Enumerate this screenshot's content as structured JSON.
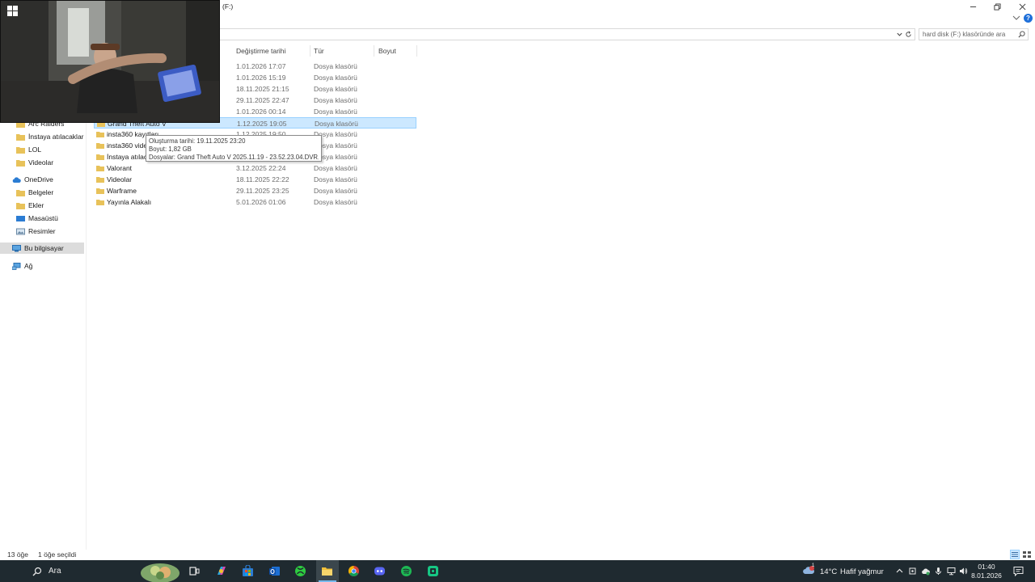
{
  "window": {
    "title": "(F:)",
    "search_placeholder": "hard disk (F:) klasöründe ara"
  },
  "columns": {
    "date": "Değiştirme tarihi",
    "type": "Tür",
    "size": "Boyut"
  },
  "files": [
    {
      "name": "",
      "date": "1.01.2026 17:07",
      "type": "Dosya klasörü"
    },
    {
      "name": "",
      "date": "1.01.2026 15:19",
      "type": "Dosya klasörü"
    },
    {
      "name": "",
      "date": "18.11.2025 21:15",
      "type": "Dosya klasörü"
    },
    {
      "name": "",
      "date": "29.11.2025 22:47",
      "type": "Dosya klasörü"
    },
    {
      "name": "",
      "date": "1.01.2026 00:14",
      "type": "Dosya klasörü"
    },
    {
      "name": "Grand Theft Auto V",
      "date": "1.12.2025 19:05",
      "type": "Dosya klasörü"
    },
    {
      "name": "insta360 kayıtları",
      "date": "1.12.2025 19:50",
      "type": "Dosya klasörü"
    },
    {
      "name": "insta360 videoları",
      "date": "",
      "type": "Dosya klasörü"
    },
    {
      "name": "İnstaya atılacaklar",
      "date": "",
      "type": "Dosya klasörü"
    },
    {
      "name": "Valorant",
      "date": "3.12.2025 22:24",
      "type": "Dosya klasörü"
    },
    {
      "name": "Videolar",
      "date": "18.11.2025 22:22",
      "type": "Dosya klasörü"
    },
    {
      "name": "Warframe",
      "date": "29.11.2025 23:25",
      "type": "Dosya klasörü"
    },
    {
      "name": "Yayınla Alakalı",
      "date": "5.01.2026 01:06",
      "type": "Dosya klasörü"
    }
  ],
  "tooltip": {
    "created": "Oluşturma tarihi: 19.11.2025 23:20",
    "size": "Boyut: 1,82 GB",
    "files": "Dosyalar: Grand Theft Auto V 2025.11.19 - 23.52.23.04.DVR, ..."
  },
  "nav": {
    "quick": [
      "Arc Raiders",
      "İnstaya atılacaklar",
      "LOL",
      "Videolar"
    ],
    "onedrive": "OneDrive",
    "onedrive_items": [
      "Belgeler",
      "Ekler",
      "Masaüstü",
      "Resimler"
    ],
    "this_pc": "Bu bilgisayar",
    "network": "Ağ"
  },
  "status": {
    "count": "13 öğe",
    "selected": "1 öğe seçildi"
  },
  "taskbar": {
    "search_label": "Ara",
    "temperature": "14°C",
    "weather": "Hafif yağmur",
    "weather_badge": "1",
    "time": "01:40",
    "date": "8.01.2026"
  },
  "colors": {
    "selection": "#cce8ff",
    "selection_border": "#99d1ff",
    "folder": "#e8c25a",
    "taskbar": "#1f2a30",
    "accent": "#1e6fd9"
  }
}
